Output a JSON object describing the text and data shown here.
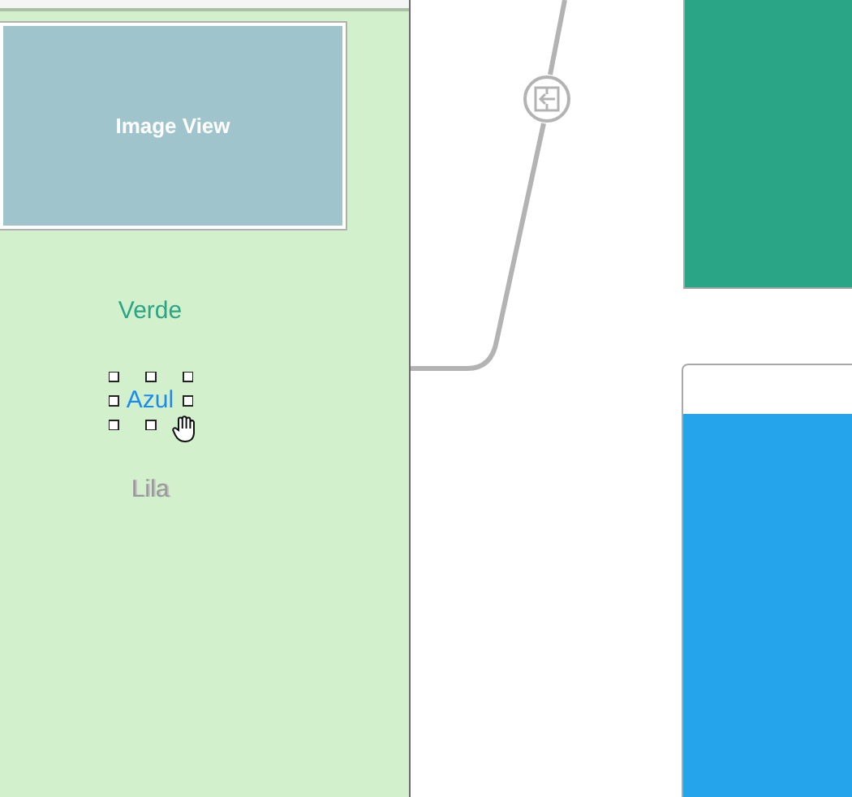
{
  "scene_left": {
    "image_view": {
      "label": "Image View"
    },
    "labels": [
      {
        "text": "Verde",
        "color": "#2aa585",
        "selected": false,
        "dimmed": false
      },
      {
        "text": "Azul",
        "color": "#1a8cf0",
        "selected": true,
        "dimmed": false
      },
      {
        "text": "Lila",
        "color": "#9a9a9a",
        "selected": false,
        "dimmed": true
      }
    ]
  },
  "scenes_right": [
    {
      "kind": "plain",
      "color": "#2aa585"
    },
    {
      "kind": "header",
      "color": "#25a3eb"
    }
  ]
}
